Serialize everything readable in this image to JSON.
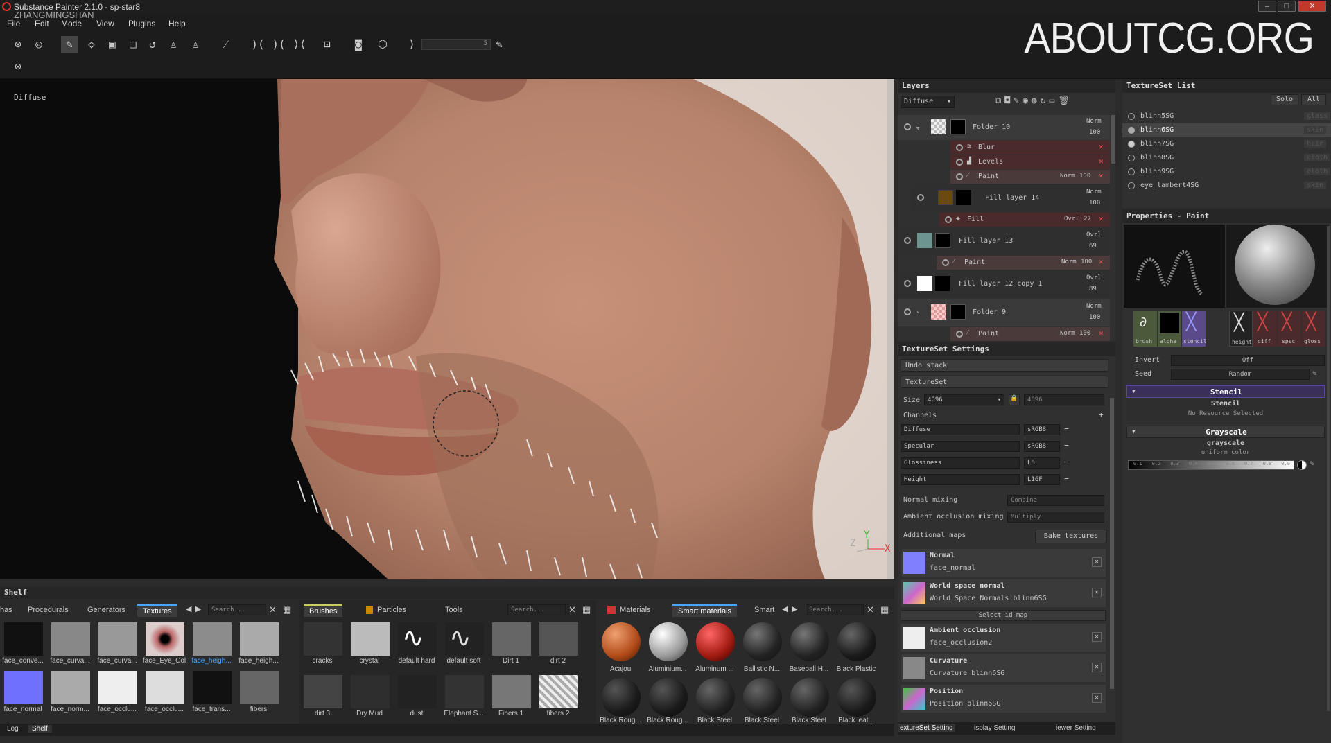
{
  "window": {
    "title": "Substance Painter 2.1.0 - sp-star8",
    "watermark_sub": "ZHANGMINGSHAN",
    "controls": [
      "–",
      "□",
      "✕"
    ]
  },
  "menu": [
    "File",
    "Edit",
    "Mode",
    "View",
    "Plugins",
    "Help"
  ],
  "watermark": "ABOUTCG.ORG",
  "toolbar": {
    "brush_size": "5"
  },
  "viewport": {
    "label": "Diffuse",
    "axes": {
      "z": "Z",
      "y": "Y",
      "x": "X"
    }
  },
  "layers": {
    "title": "Layers",
    "channel": "Diffuse",
    "items": [
      {
        "name": "Folder 10",
        "mode": "Norm",
        "opacity": "100"
      },
      {
        "name": "Blur",
        "mode": "",
        "opacity": ""
      },
      {
        "name": "Levels",
        "mode": "",
        "opacity": ""
      },
      {
        "name": "Paint",
        "mode": "Norm",
        "opacity": "100"
      },
      {
        "name": "Fill layer 14",
        "mode": "Norm",
        "opacity": "100"
      },
      {
        "name": "Fill",
        "mode": "Ovrl",
        "opacity": "27"
      },
      {
        "name": "Fill layer 13",
        "mode": "Ovrl",
        "opacity": "69"
      },
      {
        "name": "Paint",
        "mode": "Norm",
        "opacity": "100"
      },
      {
        "name": "Fill layer 12 copy 1",
        "mode": "Ovrl",
        "opacity": "89"
      },
      {
        "name": "Folder 9",
        "mode": "Norm",
        "opacity": "100"
      },
      {
        "name": "Paint",
        "mode": "Norm",
        "opacity": "100"
      }
    ]
  },
  "textureset_settings": {
    "title": "TextureSet Settings",
    "undo": "Undo stack",
    "textureset": "TextureSet",
    "size_label": "Size",
    "size": "4096",
    "size2": "4096",
    "channels_label": "Channels",
    "channels": [
      {
        "name": "Diffuse",
        "format": "sRGB8"
      },
      {
        "name": "Specular",
        "format": "sRGB8"
      },
      {
        "name": "Glossiness",
        "format": "L8"
      },
      {
        "name": "Height",
        "format": "L16F"
      }
    ],
    "normal_mixing_label": "Normal mixing",
    "normal_mixing": "Combine",
    "ao_mixing_label": "Ambient occlusion mixing",
    "ao_mixing": "Multiply",
    "additional_maps": "Additional maps",
    "bake_button": "Bake textures",
    "select_id_map": "Select id map",
    "maps": [
      {
        "title": "Normal",
        "value": "face_normal"
      },
      {
        "title": "World space normal",
        "value": "World Space Normals blinn6SG"
      },
      {
        "title": "Ambient occlusion",
        "value": "face_occlusion2"
      },
      {
        "title": "Curvature",
        "value": "Curvature blinn6SG"
      },
      {
        "title": "Position",
        "value": "Position blinn6SG"
      }
    ],
    "bottom_tabs": [
      "extureSet Setting",
      "isplay Setting",
      "iewer Setting"
    ]
  },
  "textureset_list": {
    "title": "TextureSet List",
    "solo": "Solo",
    "all": "All",
    "items": [
      {
        "name": "blinn5SG",
        "shader": "glass"
      },
      {
        "name": "blinn6SG",
        "shader": "skin"
      },
      {
        "name": "blinn7SG",
        "shader": "hair"
      },
      {
        "name": "blinn8SG",
        "shader": "cloth"
      },
      {
        "name": "blinn9SG",
        "shader": "cloth"
      },
      {
        "name": "eye_lambert4SG",
        "shader": "skin"
      }
    ]
  },
  "properties": {
    "title": "Properties - Paint",
    "slots": [
      "brush",
      "alpha",
      "stencil",
      "height",
      "diff",
      "spec",
      "gloss"
    ],
    "invert_label": "Invert",
    "invert": "Off",
    "seed_label": "Seed",
    "seed": "Random",
    "stencil_header": "Stencil",
    "stencil_name": "Stencil",
    "stencil_value": "No Resource Selected",
    "grayscale_header": "Grayscale",
    "grayscale_name": "grayscale",
    "grayscale_value": "uniform color",
    "ticks": [
      "0.1",
      "0.2",
      "0.3",
      "0.4",
      "0.5",
      "0.6",
      "0.7",
      "0.8",
      "0.9"
    ]
  },
  "shelf": {
    "title": "Shelf",
    "tabs1": [
      "has",
      "Procedurals",
      "Generators",
      "Textures"
    ],
    "tabs2": [
      "Brushes",
      "Particles",
      "Tools"
    ],
    "tabs3": [
      "Materials",
      "Smart materials",
      "Smart"
    ],
    "search": "Search...",
    "textures": [
      "face_conve...",
      "face_curva...",
      "face_curva...",
      "face_Eye_Col",
      "face_heigh...",
      "face_heigh...",
      "face_normal",
      "face_norm...",
      "face_occlu...",
      "face_occlu...",
      "face_trans...",
      "fibers"
    ],
    "brushes": [
      "cracks",
      "crystal",
      "default hard",
      "default soft",
      "Dirt 1",
      "dirt 2",
      "dirt 3",
      "Dry Mud",
      "dust",
      "Elephant S...",
      "Fibers 1",
      "fibers 2"
    ],
    "materials": [
      "Acajou",
      "Aluminium...",
      "Aluminum ...",
      "Ballistic N...",
      "Baseball H...",
      "Black Plastic",
      "Black Roug...",
      "Black Roug...",
      "Black Steel",
      "Black Steel",
      "Black Steel",
      "Black leat..."
    ],
    "bottom_tabs": [
      "Log",
      "Shelf"
    ]
  }
}
